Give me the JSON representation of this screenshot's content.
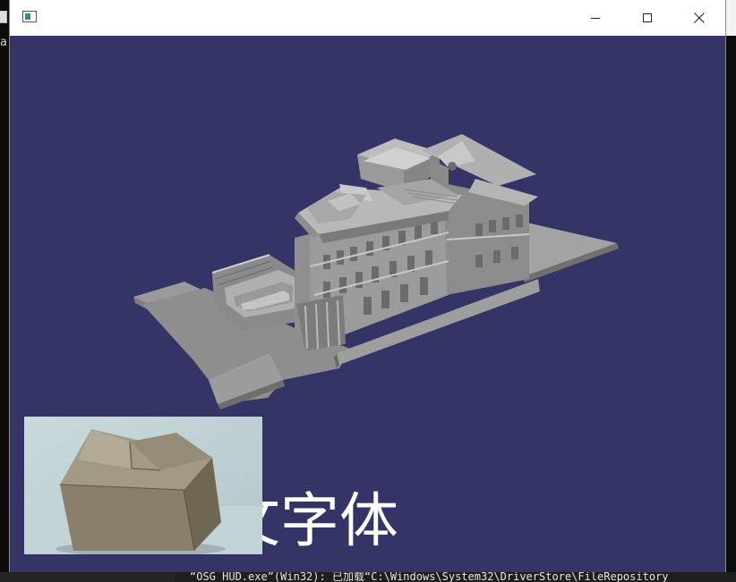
{
  "window": {
    "title": "",
    "controls": {
      "minimize_icon": "minimize-icon",
      "maximize_icon": "maximize-icon",
      "close_icon": "close-icon"
    }
  },
  "console": {
    "left_char": "a"
  },
  "viewport": {
    "background_color": "#343466",
    "model_color": "#a0a0a0"
  },
  "hud": {
    "text": "中文字体"
  },
  "output_line": "“OSG_HUD.exe”(Win32): 已加载“C:\\Windows\\System32\\DriverStore\\FileRepository"
}
